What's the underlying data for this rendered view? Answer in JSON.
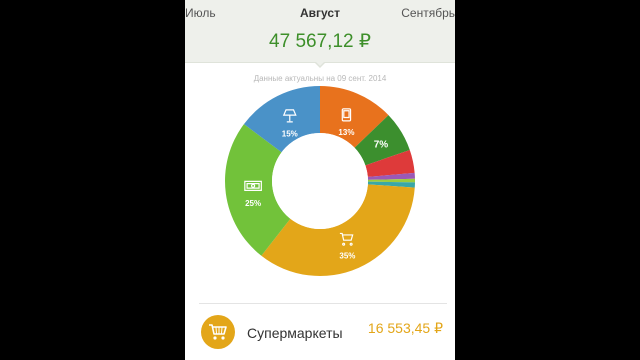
{
  "header": {
    "prev_month": "Июль",
    "current_month": "Август",
    "next_month": "Сентябрь",
    "total": "47 567,12 ₽",
    "date_note": "Данные актуальны на 09 сент. 2014"
  },
  "colors": {
    "header_bg": "#eef0eb",
    "total_text": "#3d8f2a",
    "supermarkets": "#e3a619"
  },
  "chart_data": {
    "type": "pie",
    "categories": [
      "electronics",
      "other-green",
      "red",
      "purple",
      "light-green",
      "teal",
      "supermarkets",
      "cash",
      "home"
    ],
    "values": [
      13,
      7,
      4,
      1,
      0.6,
      0.9,
      35,
      25,
      15
    ],
    "colors": [
      "#e8721d",
      "#3c8f2e",
      "#de3a3a",
      "#9b59b6",
      "#9ccc3d",
      "#3aa7a7",
      "#e3a619",
      "#72c23a",
      "#4a92c8"
    ],
    "labels": [
      "13%",
      "7%",
      "",
      "",
      "",
      "",
      "35%",
      "25%",
      "15%"
    ],
    "icons": [
      "phone-icon",
      "",
      "",
      "",
      "",
      "",
      "cart-icon",
      "cash-icon",
      "lamp-icon"
    ]
  },
  "category_list": [
    {
      "label": "Супермаркеты",
      "value": "16 553,45 ₽",
      "icon": "cart-icon"
    }
  ]
}
